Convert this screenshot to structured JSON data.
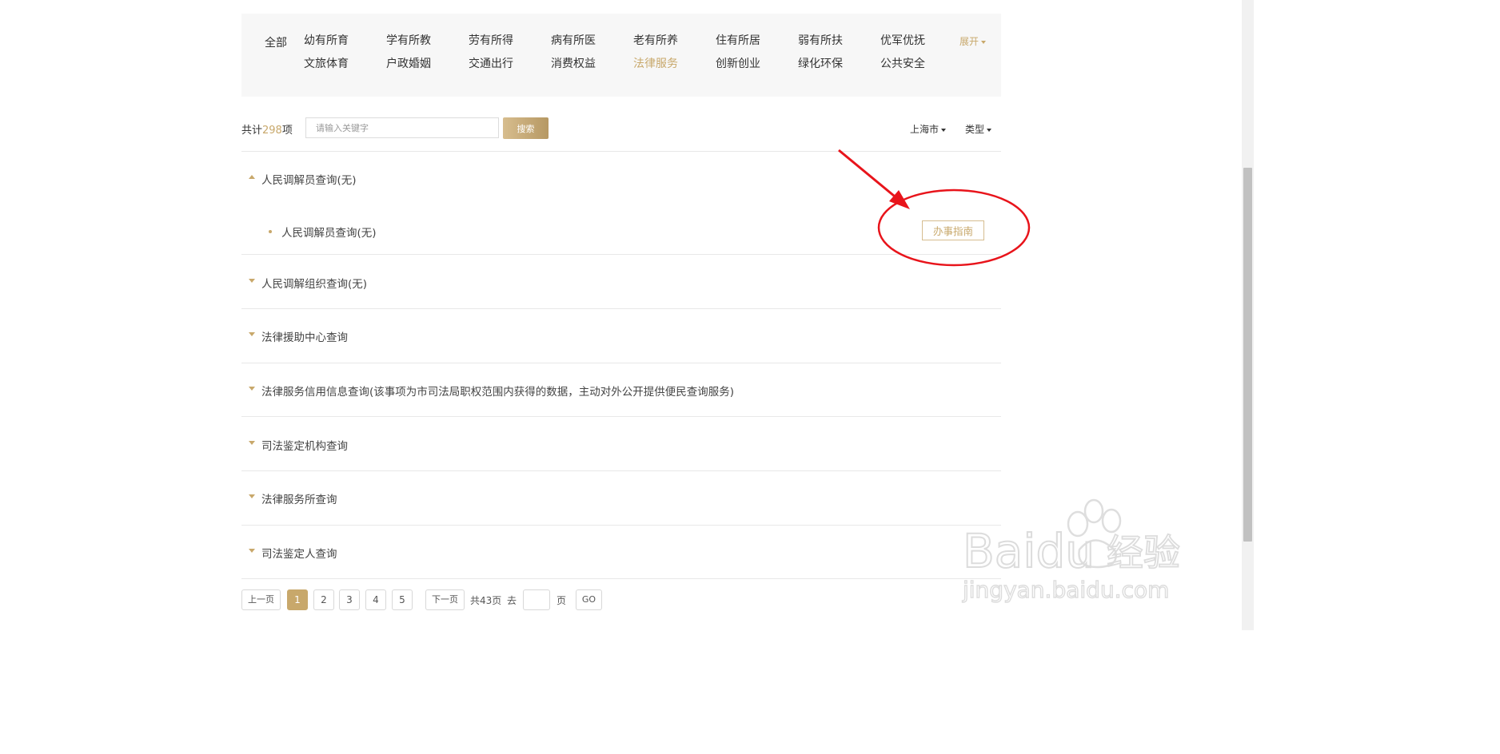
{
  "categories": {
    "all_label": "全部",
    "items": [
      {
        "label": "幼有所育"
      },
      {
        "label": "学有所教"
      },
      {
        "label": "劳有所得"
      },
      {
        "label": "病有所医"
      },
      {
        "label": "老有所养"
      },
      {
        "label": "住有所居"
      },
      {
        "label": "弱有所扶"
      },
      {
        "label": "优军优抚"
      },
      {
        "label": "文旅体育"
      },
      {
        "label": "户政婚姻"
      },
      {
        "label": "交通出行"
      },
      {
        "label": "消费权益"
      },
      {
        "label": "法律服务"
      },
      {
        "label": "创新创业"
      },
      {
        "label": "绿化环保"
      },
      {
        "label": "公共安全"
      }
    ],
    "active_label": "法律服务",
    "expand_label": "展开"
  },
  "search": {
    "total_prefix": "共计",
    "total_count": "298",
    "total_suffix": "项",
    "placeholder": "请输入关键字",
    "button_label": "搜索",
    "city_label": "上海市",
    "type_label": "类型"
  },
  "items": [
    {
      "title": "人民调解员查询(无)",
      "expanded": true,
      "sub_items": [
        {
          "title": "人民调解员查询(无)",
          "guide_label": "办事指南"
        }
      ]
    },
    {
      "title": "人民调解组织查询(无)"
    },
    {
      "title": "法律援助中心查询"
    },
    {
      "title": "法律服务信用信息查询(该事项为市司法局职权范围内获得的数据，主动对外公开提供便民查询服务)"
    },
    {
      "title": "司法鉴定机构查询"
    },
    {
      "title": "法律服务所查询"
    },
    {
      "title": "司法鉴定人查询"
    }
  ],
  "pagination": {
    "prev_label": "上一页",
    "pages": [
      "1",
      "2",
      "3",
      "4",
      "5"
    ],
    "current_page": "1",
    "next_label": "下一页",
    "total_text": "共43页",
    "goto_label": "去",
    "page_unit": "页",
    "go_label": "GO"
  },
  "colors": {
    "accent": "#c8a86b",
    "annotation": "#e8141b",
    "panel_bg": "#f7f7f7"
  },
  "watermark": {
    "brand": "Baidu",
    "brand_cn": "经验",
    "url": "jingyan.baidu.com"
  }
}
